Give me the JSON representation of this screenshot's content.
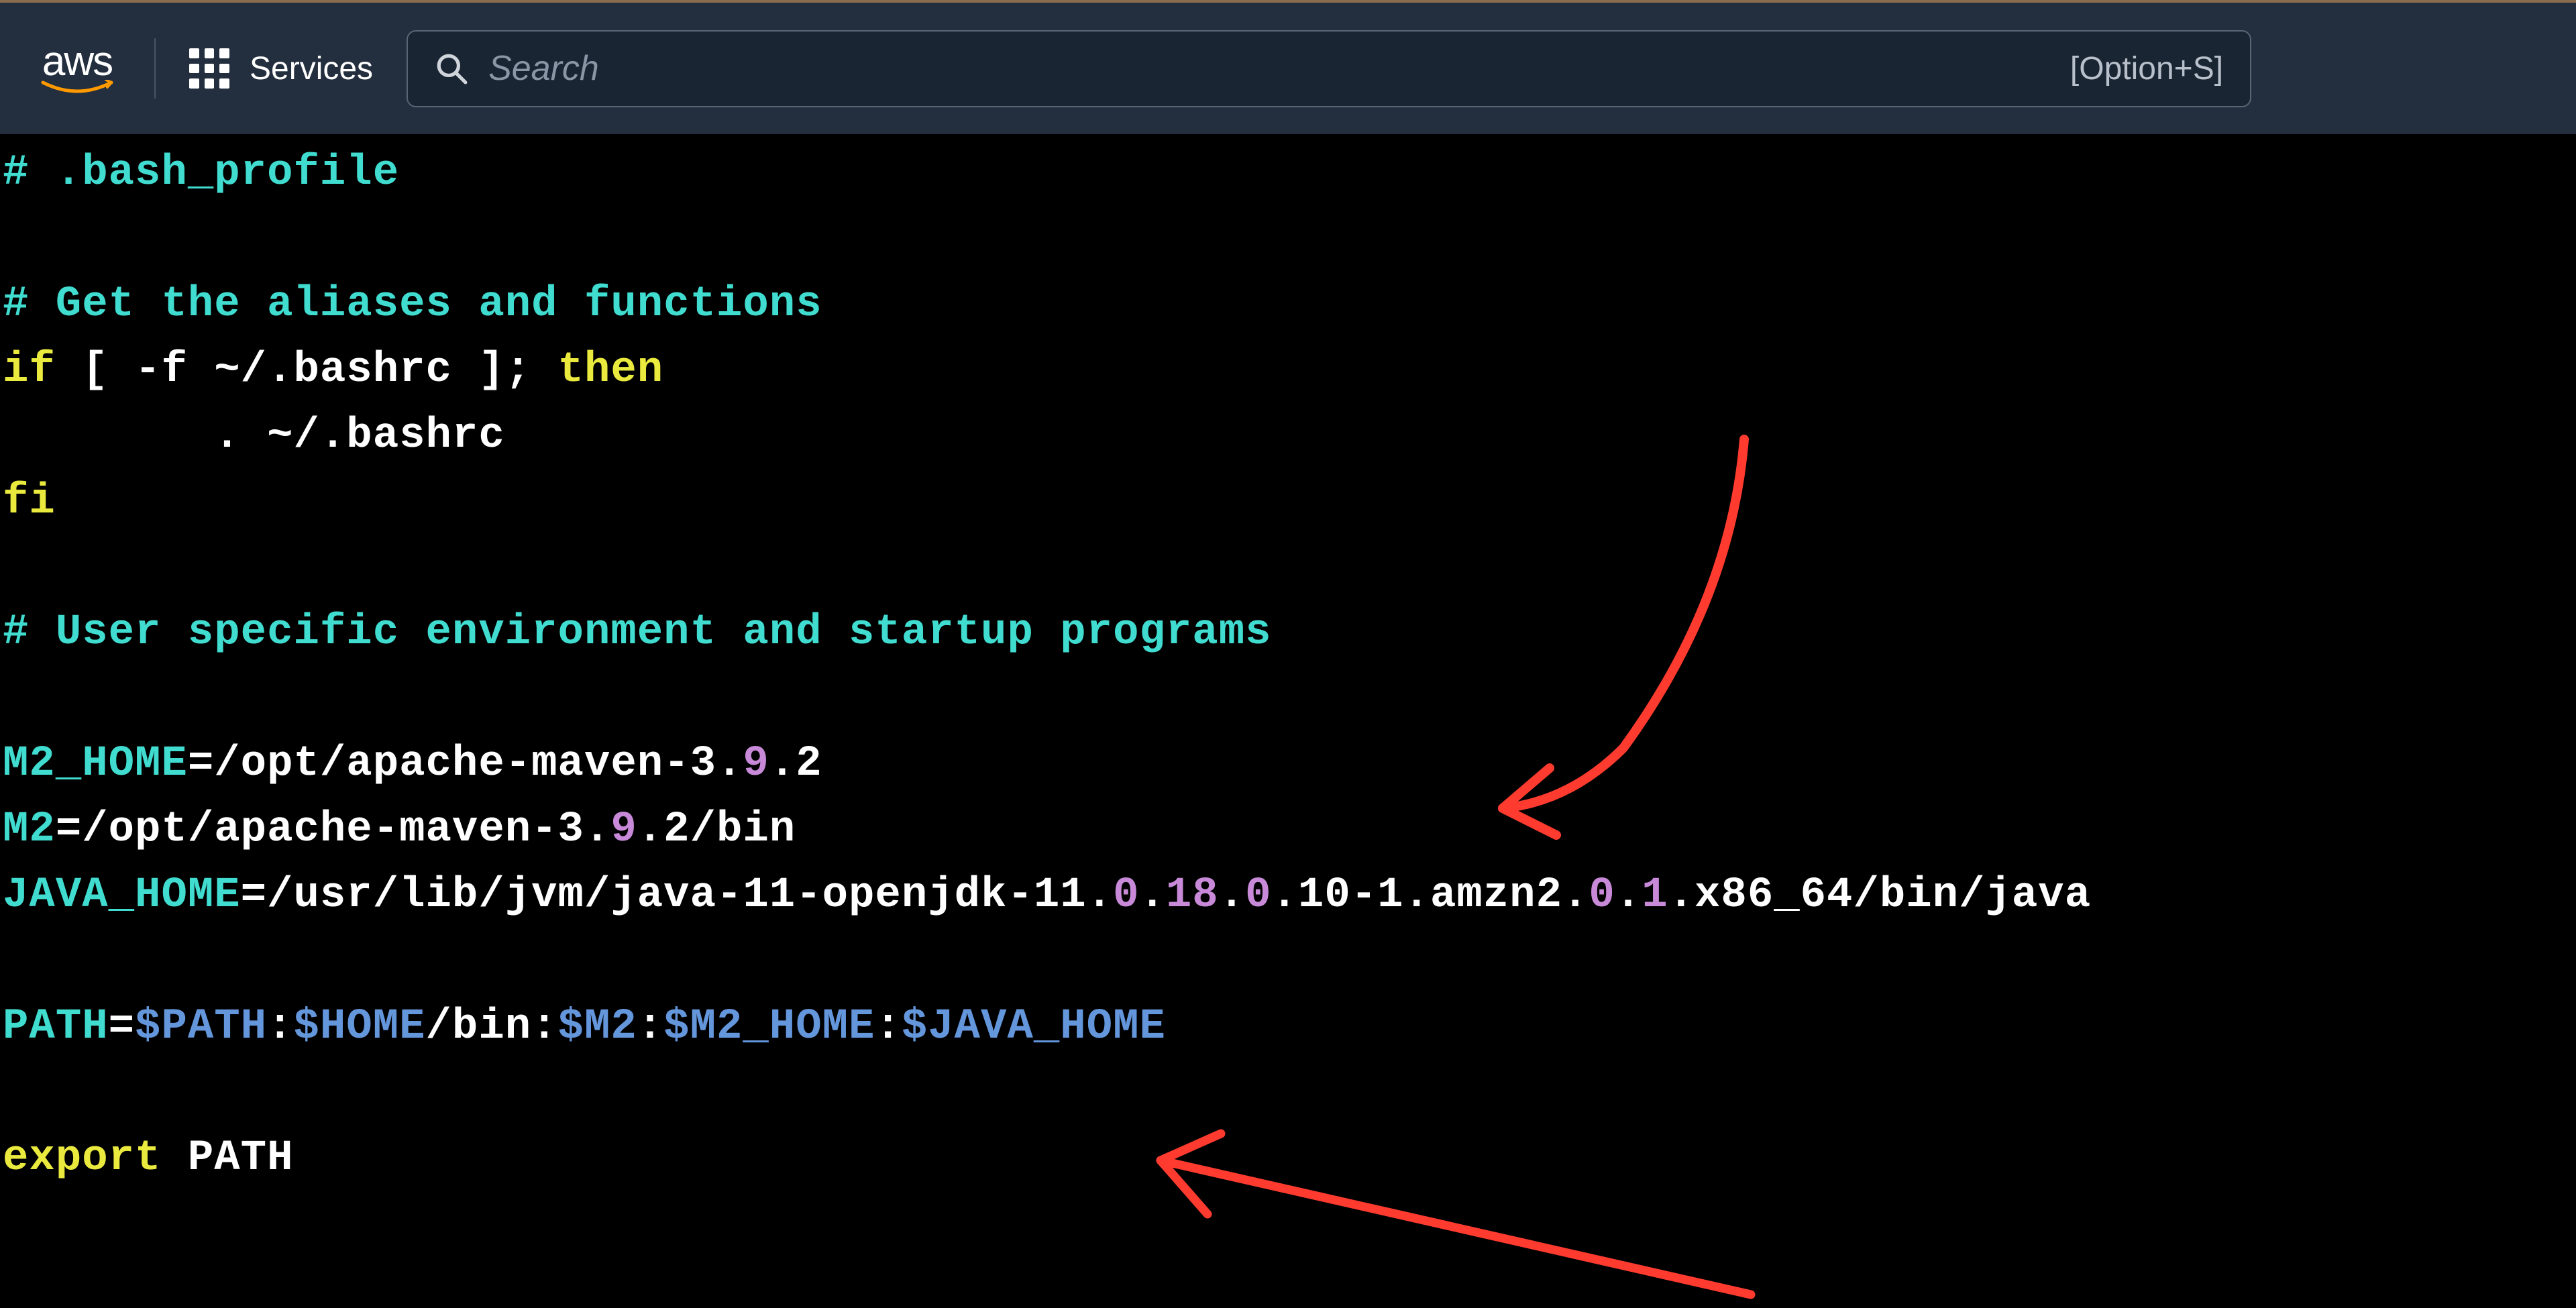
{
  "header": {
    "logo_text": "aws",
    "services_label": "Services",
    "search_placeholder": "Search",
    "search_shortcut": "[Option+S]"
  },
  "terminal": {
    "line1_comment": "# .bash_profile",
    "line2_comment": "# Get the aliases and functions",
    "line3_if": "if",
    "line3_cond": " [ -f ~/.bashrc ]; ",
    "line3_then": "then",
    "line4_source": "        . ~/.bashrc",
    "line5_fi": "fi",
    "line6_comment": "# User specific environment and startup programs",
    "m2home_key": "M2_HOME",
    "m2home_eq": "=/opt/apache-maven-",
    "m2home_v1": "3",
    "m2home_dot1": ".",
    "m2home_v2": "9",
    "m2home_dot2": ".",
    "m2home_v3": "2",
    "m2_key": "M2",
    "m2_eq": "=/opt/apache-maven-",
    "m2_v1": "3",
    "m2_dot1": ".",
    "m2_v2": "9",
    "m2_dot2": ".",
    "m2_v3": "2",
    "m2_bin": "/bin",
    "jh_key": "JAVA_HOME",
    "jh_p1": "=/usr/lib/jvm/java-",
    "jh_n1": "11",
    "jh_p2": "-openjdk-",
    "jh_n2": "11",
    "jh_d1": ".",
    "jh_pn1": "0",
    "jh_d2": ".",
    "jh_pn2": "18",
    "jh_d3": ".",
    "jh_pn3": "0",
    "jh_d4": ".",
    "jh_n3": "10",
    "jh_p3": "-",
    "jh_n4": "1",
    "jh_p4": ".amzn2.",
    "jh_pn4": "0",
    "jh_d5": ".",
    "jh_pn5": "1",
    "jh_p5": ".x86_64/bin/java",
    "path_key": "PATH",
    "path_eq": "=",
    "path_v1": "$PATH",
    "path_c1": ":",
    "path_v2": "$HOME",
    "path_bin": "/bin:",
    "path_v3": "$M2",
    "path_c2": ":",
    "path_v4": "$M2_HOME",
    "path_c3": ":",
    "path_v5": "$JAVA_HOME",
    "export_kw": "export",
    "export_var": " PATH"
  }
}
